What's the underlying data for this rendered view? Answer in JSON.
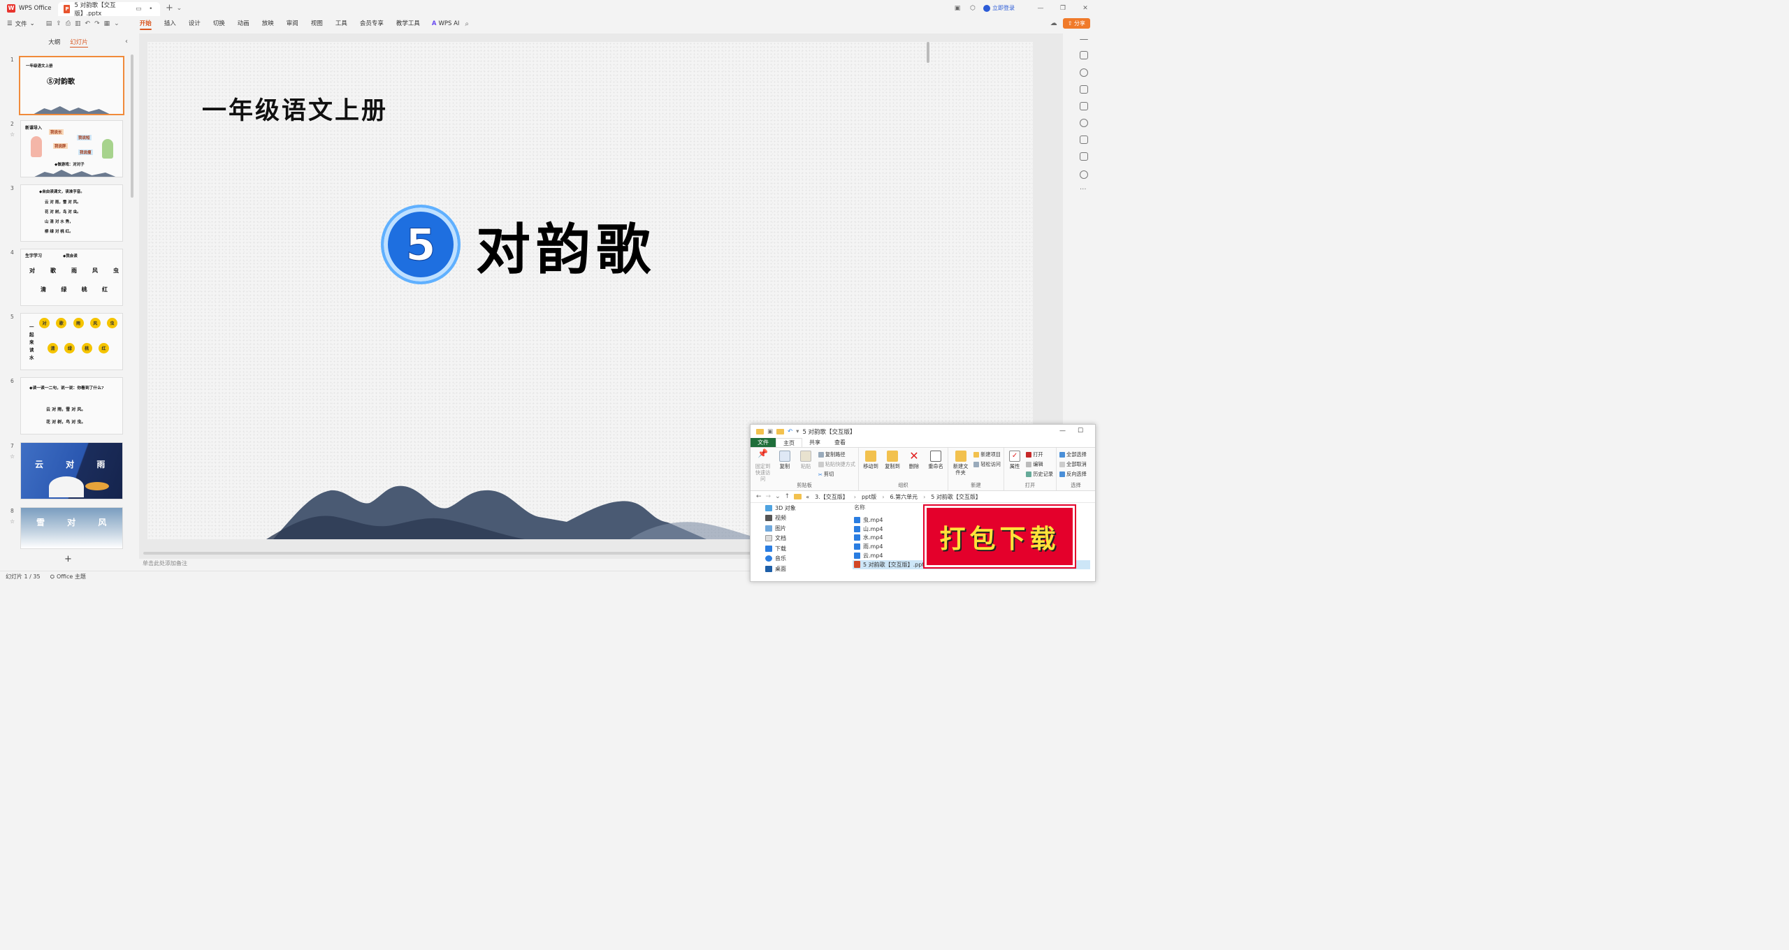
{
  "titlebar": {
    "app_name": "WPS Office",
    "doc_tab": "5 对韵歌【交互版】.pptx",
    "login": "立即登录"
  },
  "menubar": {
    "file": "文件",
    "tabs": [
      "开始",
      "插入",
      "设计",
      "切换",
      "动画",
      "放映",
      "审阅",
      "视图",
      "工具",
      "会员专享",
      "教学工具"
    ],
    "active_tab": "开始",
    "wps_ai": "WPS AI",
    "share": "分享"
  },
  "left_panel": {
    "tabs": [
      "大纲",
      "幻灯片"
    ],
    "active_tab": "幻灯片",
    "thumbs": [
      {
        "num": "1",
        "t1": "一年级语文上册",
        "t2": "⑤对韵歌"
      },
      {
        "num": "2",
        "t1": "新课导入",
        "t2": "◆做游戏：对对子",
        "tags": [
          "我说长",
          "我说短",
          "我说胖",
          "我说瘦"
        ]
      },
      {
        "num": "3",
        "t1": "◆自由读课文，读准字音。",
        "lines": [
          "云 对 雨，雪 对 风。",
          "花 对 树，鸟 对 虫。",
          "山 清 对 水 秀，",
          "柳 绿 对 桃 红。"
        ]
      },
      {
        "num": "4",
        "t1": "生字学习",
        "t2": "◆我会读",
        "row1": [
          "对",
          "歌",
          "雨",
          "风",
          "虫"
        ],
        "row2": [
          "清",
          "绿",
          "桃",
          "红"
        ]
      },
      {
        "num": "5",
        "t1": "一起来读水",
        "row1": [
          "对",
          "歌",
          "雨",
          "风",
          "虫"
        ],
        "row2": [
          "清",
          "绿",
          "桃",
          "红"
        ]
      },
      {
        "num": "6",
        "t1": "◆读一读一二句，说一说：你看到了什么?",
        "lines": [
          "云 对 雨，雪 对 风。",
          "花 对 树，鸟 对 虫。"
        ]
      },
      {
        "num": "7",
        "t1": "云 对 雨"
      },
      {
        "num": "8",
        "t1": "雪 对 风"
      }
    ]
  },
  "slide": {
    "subtitle": "一年级语文上册",
    "lesson_number": "5",
    "title": "对韵歌"
  },
  "notes_placeholder": "单击此处添加备注",
  "statusbar": {
    "slide_info": "幻灯片 1 / 35",
    "theme": "Office 主题"
  },
  "explorer": {
    "title": "5 对韵歌【交互版】",
    "tabs": [
      "文件",
      "主页",
      "共享",
      "查看"
    ],
    "active_tab": "主页",
    "groups": {
      "clipboard": {
        "label": "剪贴板",
        "pin": "固定到快速访问",
        "copy": "复制",
        "paste": "粘贴",
        "copy_path": "复制路径",
        "paste_shortcut": "粘贴快捷方式",
        "cut": "剪切"
      },
      "organize": {
        "label": "组织",
        "move_to": "移动到",
        "copy_to": "复制到",
        "delete": "删除",
        "rename": "重命名"
      },
      "new": {
        "label": "新建",
        "new_folder": "新建文件夹",
        "new_item": "新建项目",
        "easy_access": "轻松访问"
      },
      "open": {
        "label": "打开",
        "properties": "属性",
        "open": "打开",
        "edit": "编辑",
        "history": "历史记录"
      },
      "select": {
        "label": "选择",
        "select_all": "全部选择",
        "select_none": "全部取消",
        "invert": "反向选择"
      }
    },
    "breadcrumb": [
      "«",
      "3.【交互版】",
      "ppt版",
      "6.第六单元",
      "5 对韵歌【交互版】"
    ],
    "tree": [
      "3D 对象",
      "视频",
      "图片",
      "文档",
      "下载",
      "音乐",
      "桌面"
    ],
    "column_name": "名称",
    "files": [
      "虫.mp4",
      "山.mp4",
      "水.mp4",
      "雨.mp4",
      "云.mp4",
      "5 对韵歌【交互版】.pptx"
    ]
  },
  "banner": {
    "text": "打包下载"
  }
}
